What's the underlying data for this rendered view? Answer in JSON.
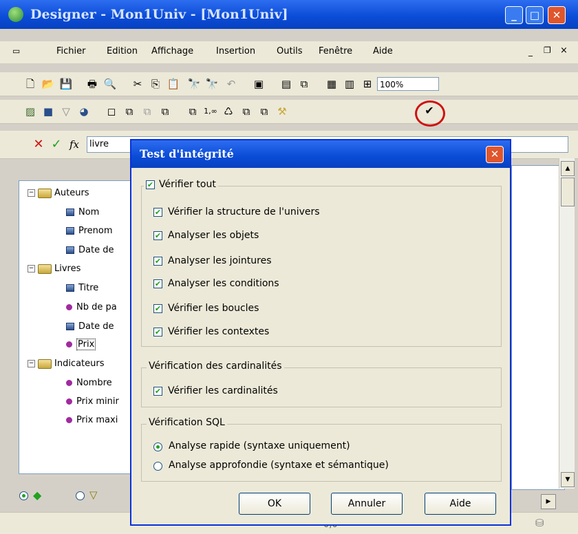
{
  "window": {
    "title": "Designer - Mon1Univ - [Mon1Univ]"
  },
  "menu": [
    "Fichier",
    "Edition",
    "Affichage",
    "Insertion",
    "Outils",
    "Fenêtre",
    "Aide"
  ],
  "toolbar": {
    "zoom": "100%"
  },
  "formula_bar": {
    "value": "livre"
  },
  "tree": {
    "folders": [
      {
        "label": "Auteurs",
        "items": [
          {
            "label": "Nom",
            "kind": "dimension"
          },
          {
            "label": "Prenom",
            "kind": "dimension"
          },
          {
            "label": "Date de",
            "kind": "dimension"
          }
        ]
      },
      {
        "label": "Livres",
        "items": [
          {
            "label": "Titre",
            "kind": "dimension"
          },
          {
            "label": "Nb de pa",
            "kind": "measure"
          },
          {
            "label": "Date de",
            "kind": "dimension"
          },
          {
            "label": "Prix",
            "kind": "measure"
          }
        ]
      },
      {
        "label": "Indicateurs",
        "items": [
          {
            "label": "Nombre",
            "kind": "measure"
          },
          {
            "label": "Prix minir",
            "kind": "measure"
          },
          {
            "label": "Prix maxi",
            "kind": "measure"
          }
        ]
      }
    ]
  },
  "status": {
    "value": "0,0"
  },
  "dialog": {
    "title": "Test d'intégrité",
    "checks": [
      {
        "label": "Vérifier tout",
        "checked": true
      },
      {
        "label": "Vérifier la structure de l'univers",
        "checked": true
      },
      {
        "label": "Analyser les objets",
        "checked": true
      },
      {
        "label": "Analyser les jointures",
        "checked": true
      },
      {
        "label": "Analyser les conditions",
        "checked": true
      },
      {
        "label": "Vérifier les boucles",
        "checked": true
      },
      {
        "label": "Vérifier les contextes",
        "checked": true
      }
    ],
    "cardinality_group": "Vérification des cardinalités",
    "cardinality_check": {
      "label": "Vérifier les cardinalités",
      "checked": true
    },
    "sql_group": "Vérification SQL",
    "sql_options": [
      {
        "label": "Analyse rapide (syntaxe uniquement)",
        "selected": true
      },
      {
        "label": "Analyse approfondie (syntaxe et sémantique)",
        "selected": false
      }
    ],
    "buttons": {
      "ok": "OK",
      "cancel": "Annuler",
      "help": "Aide"
    }
  },
  "colors": {
    "titlebar": "#0a4bd6",
    "highlight": "#d01010",
    "checkmark": "#21a121"
  }
}
